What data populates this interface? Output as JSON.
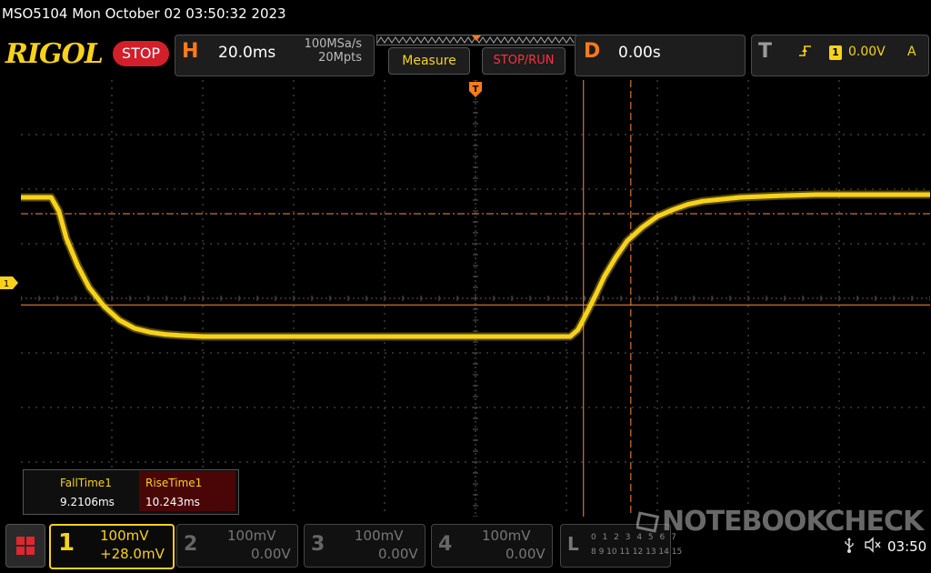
{
  "titlebar": {
    "text": "MSO5104  Mon October 02 03:50:32 2023"
  },
  "logo": {
    "text": "RIGOL"
  },
  "run_state": {
    "label": "STOP"
  },
  "horizontal": {
    "letter": "H",
    "timebase": "20.0ms",
    "sample_rate": "100MSa/s",
    "memory_depth": "20Mpts"
  },
  "buttons": {
    "measure": "Measure",
    "stop_run": "STOP/RUN"
  },
  "delay": {
    "letter": "D",
    "value": "0.00s"
  },
  "trigger": {
    "letter": "T",
    "edge_icon": "rising-edge-icon",
    "source": "1",
    "level": "0.00V",
    "mode": "A"
  },
  "measurements": {
    "items": [
      {
        "name": "FallTime1",
        "value": "9.2106ms"
      },
      {
        "name": "RiseTime1",
        "value": "10.243ms"
      }
    ]
  },
  "channels": [
    {
      "num": "1",
      "scale": "100mV",
      "offset": "+28.0mV",
      "active": true,
      "color": "#f7d21a"
    },
    {
      "num": "2",
      "scale": "100mV",
      "offset": "0.00V",
      "active": false
    },
    {
      "num": "3",
      "scale": "100mV",
      "offset": "0.00V",
      "active": false
    },
    {
      "num": "4",
      "scale": "100mV",
      "offset": "0.00V",
      "active": false
    }
  ],
  "logic": {
    "letter": "L",
    "row1": "0 1 2 3 4 5 6 7",
    "row2": "8 9 10 11 12 13 14 15"
  },
  "watermark": {
    "text": "NOTEBOOKCHECK"
  },
  "status": {
    "clock": "03:50",
    "usb_icon": "usb-icon",
    "speaker_icon": "speaker-muted-icon"
  },
  "ch1_marker": {
    "label": "1"
  },
  "colors": {
    "trace": "#f7d21a",
    "cursor": "#ff8a3a",
    "grid": "#5a5a5a",
    "accent": "#ff7a1a",
    "stop": "#d21f2a"
  },
  "chart_data": {
    "type": "line",
    "title": "",
    "xlabel": "",
    "ylabel": "",
    "x_unit": "ms",
    "y_unit": "mV",
    "xlim": [
      -120,
      120
    ],
    "ylim": [
      -400,
      400
    ],
    "series": [
      {
        "x": [
          -120,
          -112,
          -110,
          -108,
          -105,
          -102,
          -98,
          -94,
          -90,
          -86,
          -82,
          -78,
          -72,
          -60,
          -40,
          -20,
          0,
          10,
          20,
          25,
          27,
          28,
          30,
          32,
          34,
          37,
          40,
          44,
          48,
          52,
          56,
          60,
          70,
          80,
          90,
          100,
          110,
          120
        ],
        "values": [
          185,
          185,
          160,
          110,
          60,
          20,
          -15,
          -40,
          -55,
          -62,
          -66,
          -68,
          -70,
          -70,
          -70,
          -70,
          -70,
          -70,
          -70,
          -70,
          -58,
          -45,
          -18,
          10,
          40,
          75,
          105,
          130,
          150,
          162,
          172,
          178,
          185,
          188,
          190,
          190,
          190,
          190
        ]
      }
    ],
    "cursors": {
      "vertical": [
        28.5,
        41
      ],
      "horizontal": [
        155,
        -12
      ]
    },
    "trigger_position": 0,
    "grid": {
      "x_divisions": 10,
      "y_divisions": 8
    }
  }
}
